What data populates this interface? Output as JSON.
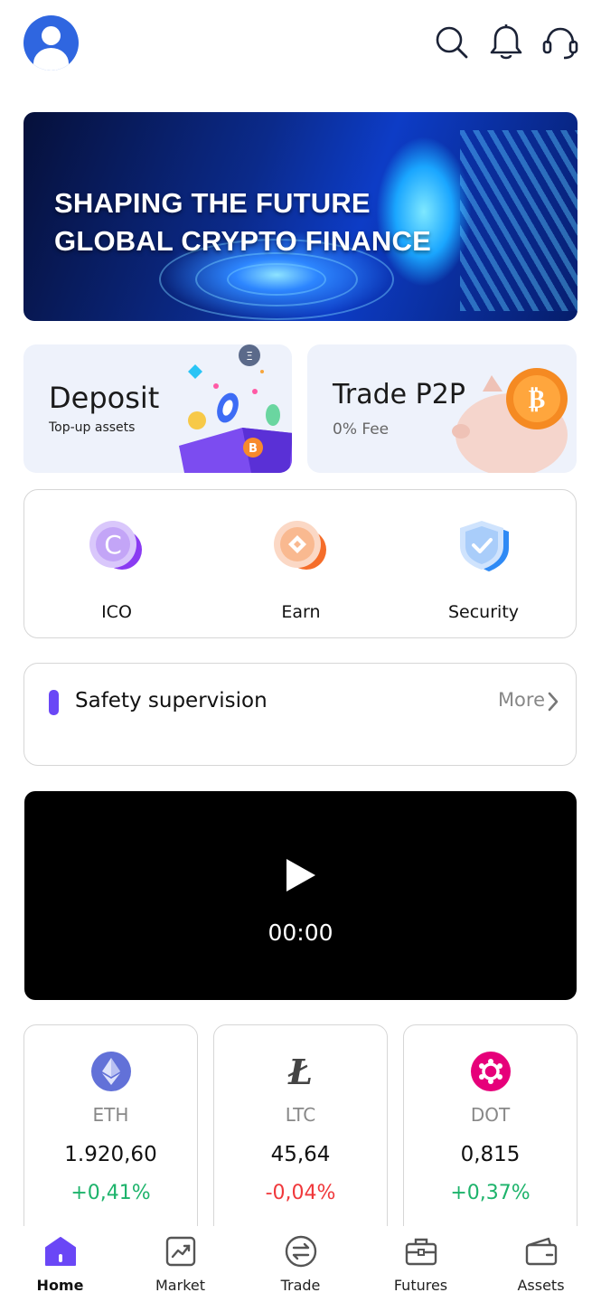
{
  "header": {
    "avatar_icon": "user-avatar-icon",
    "icons": [
      "search-icon",
      "bell-icon",
      "headset-icon"
    ]
  },
  "banner": {
    "line1": "SHAPING THE FUTURE",
    "line2": "GLOBAL CRYPTO FINANCE"
  },
  "cards": {
    "deposit": {
      "title": "Deposit",
      "subtitle": "Top-up assets"
    },
    "p2p": {
      "title": "Trade P2P",
      "subtitle": "0% Fee"
    }
  },
  "features": [
    {
      "label": "ICO",
      "icon": "ico-coin-icon"
    },
    {
      "label": "Earn",
      "icon": "earn-diamond-icon"
    },
    {
      "label": "Security",
      "icon": "shield-check-icon"
    }
  ],
  "safety": {
    "title": "Safety supervision",
    "more": "More"
  },
  "video": {
    "time": "00:00"
  },
  "tickers": [
    {
      "symbol": "ETH",
      "price": "1.920,60",
      "change": "+0,41%",
      "direction": "up",
      "color": "#6271d8"
    },
    {
      "symbol": "LTC",
      "price": "45,64",
      "change": "-0,04%",
      "direction": "down",
      "color": "#444444"
    },
    {
      "symbol": "DOT",
      "price": "0,815",
      "change": "+0,37%",
      "direction": "up",
      "color": "#e6007a"
    }
  ],
  "tabbar": [
    {
      "label": "Home",
      "icon": "home-icon",
      "active": true
    },
    {
      "label": "Market",
      "icon": "chart-icon"
    },
    {
      "label": "Trade",
      "icon": "exchange-icon"
    },
    {
      "label": "Futures",
      "icon": "briefcase-icon"
    },
    {
      "label": "Assets",
      "icon": "wallet-icon"
    }
  ],
  "colors": {
    "accent": "#6a47f6",
    "up": "#1db36b",
    "down": "#f0383b"
  }
}
